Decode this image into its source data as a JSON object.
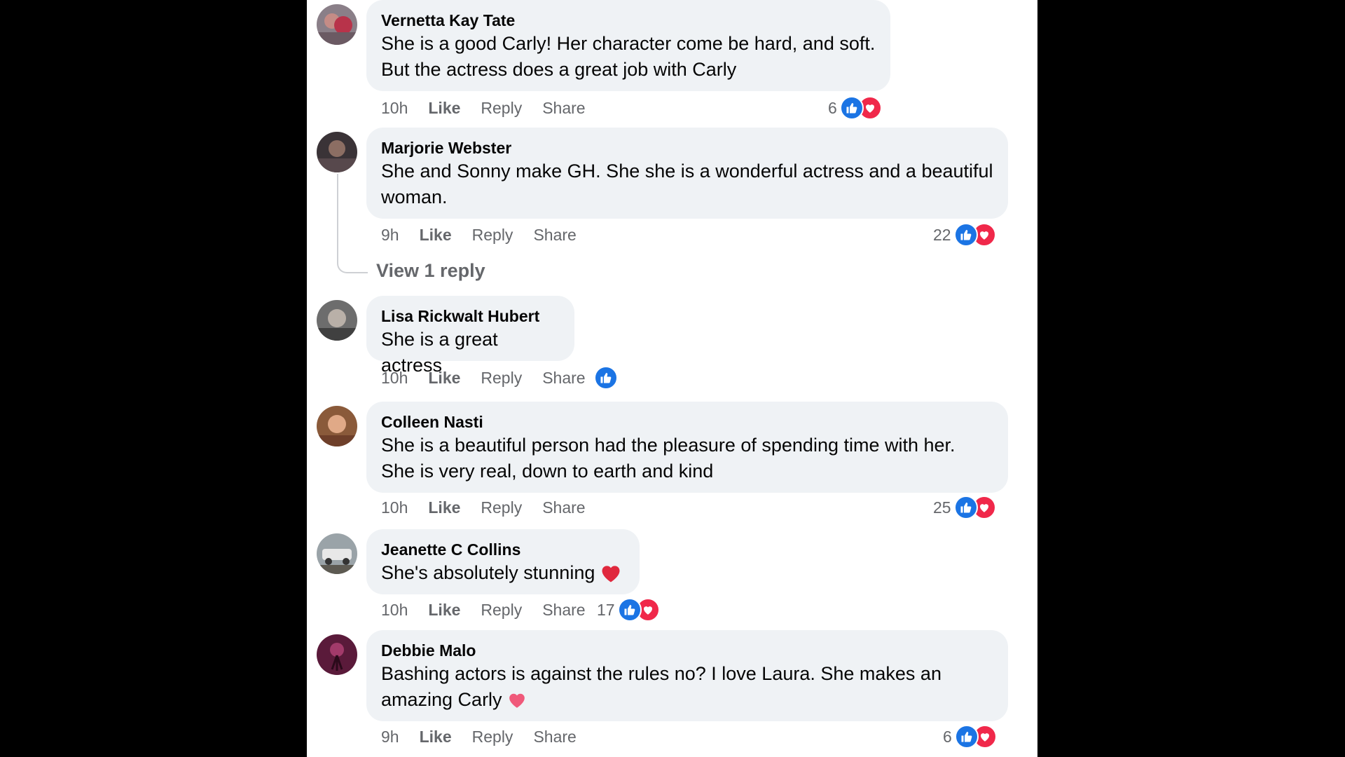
{
  "comments": [
    {
      "author": "Vernetta Kay Tate",
      "lines": [
        "She is a good Carly! Her character come be hard, and soft.",
        "But the actress does a great job with Carly"
      ],
      "time": "10h",
      "like": "Like",
      "reply": "Reply",
      "share": "Share",
      "reaction_count": "6",
      "reactions": [
        "like-icon",
        "heart-icon"
      ]
    },
    {
      "author": "Marjorie Webster",
      "lines": [
        "She and Sonny make GH. She she is a wonderful actress and a beautiful",
        "woman."
      ],
      "time": "9h",
      "like": "Like",
      "reply": "Reply",
      "share": "Share",
      "reaction_count": "22",
      "reactions": [
        "like-icon",
        "heart-icon"
      ],
      "view_replies": "View 1 reply"
    },
    {
      "author": "Lisa Rickwalt Hubert",
      "lines": [
        "She is a great actress"
      ],
      "time": "10h",
      "like": "Like",
      "reply": "Reply",
      "share": "Share",
      "reaction_count": "",
      "reactions": [
        "like-icon"
      ]
    },
    {
      "author": "Colleen Nasti",
      "lines": [
        "She is a beautiful person had the pleasure of spending time with her.",
        "She is very real, down to earth and kind"
      ],
      "time": "10h",
      "like": "Like",
      "reply": "Reply",
      "share": "Share",
      "reaction_count": "25",
      "reactions": [
        "like-icon",
        "heart-icon"
      ]
    },
    {
      "author": "Jeanette C Collins",
      "lines": [
        "She's absolutely stunning"
      ],
      "time": "10h",
      "like": "Like",
      "reply": "Reply",
      "share": "Share",
      "reaction_count": "17",
      "reactions": [
        "like-icon",
        "heart-icon"
      ]
    },
    {
      "author": "Debbie Malo",
      "lines": [
        "Bashing actors is against the rules no? I love Laura. She makes an",
        "amazing Carly"
      ],
      "time": "9h",
      "like": "Like",
      "reply": "Reply",
      "share": "Share",
      "reaction_count": "6",
      "reactions": [
        "like-icon",
        "heart-icon"
      ]
    }
  ],
  "colors": {
    "like": "#1b74e4",
    "heart": "#f0284a",
    "bubble": "#eff2f5",
    "meta": "#65676b"
  }
}
